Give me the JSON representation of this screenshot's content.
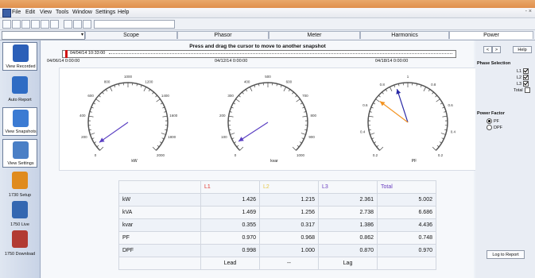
{
  "menu": {
    "items": [
      "File",
      "Edit",
      "View",
      "Tools",
      "Window",
      "Settings",
      "Help"
    ],
    "window_controls": "- ×"
  },
  "tabs": {
    "combo_arrow": "▾",
    "items": [
      "Scope",
      "Phasor",
      "Meter",
      "Harmonics",
      "Power"
    ],
    "active": "Power"
  },
  "sidebar": {
    "items": [
      {
        "label": "View Recorded",
        "color": "#2b5fb8"
      },
      {
        "label": "Auto Report",
        "color": "#2f6cc4"
      },
      {
        "label": "View Snapshots",
        "color": "#3b7bd3"
      },
      {
        "label": "View Settings",
        "color": "#4a7fc6"
      },
      {
        "label": "1730 Setup",
        "color": "#e08b1e"
      },
      {
        "label": "1750 Live",
        "color": "#3467b1"
      },
      {
        "label": "1750 Download",
        "color": "#b23a32"
      }
    ]
  },
  "main": {
    "instruction": "Press and drag the cursor to move to another snapshot",
    "marker_time": "04/04/14 10:33:00",
    "timeline_dates": [
      "04/06/14 0:00:00",
      "04/12/14 0:00:00",
      "04/18/14 0:00:00"
    ],
    "gauges": [
      {
        "unit": "kW",
        "ticks": [
          "0",
          "200",
          "400",
          "600",
          "800",
          "1000",
          "1200",
          "1400",
          "1600",
          "1800",
          "2000"
        ],
        "needles": [
          {
            "angle": 215,
            "color": "#5a3fc2"
          }
        ]
      },
      {
        "unit": "kvar",
        "ticks": [
          "0",
          "100",
          "200",
          "300",
          "400",
          "500",
          "600",
          "700",
          "800",
          "900",
          "1000"
        ],
        "needles": [
          {
            "angle": 213,
            "color": "#5a3fc2"
          }
        ]
      },
      {
        "unit": "PF",
        "ticks": [
          "0.2",
          "0.4",
          "0.6",
          "0.8",
          "1",
          "0.8",
          "0.6",
          "0.4",
          "0.2"
        ],
        "needles": [
          {
            "angle": 108,
            "color": "#2a2aa6"
          },
          {
            "angle": 143,
            "color": "#f39320"
          }
        ]
      }
    ]
  },
  "table": {
    "headers": [
      "",
      "L1",
      "L2",
      "L3",
      "Total"
    ],
    "header_colors": [
      "#111111",
      "#e0322a",
      "#e4c84a",
      "#6a3fc0",
      "#6a3fc0"
    ],
    "rows": [
      {
        "label": "kW",
        "values": [
          "1.426",
          "1.215",
          "2.361",
          "5.002"
        ]
      },
      {
        "label": "kVA",
        "values": [
          "1.469",
          "1.256",
          "2.738",
          "6.686"
        ]
      },
      {
        "label": "kvar",
        "values": [
          "0.355",
          "0.317",
          "1.386",
          "4.436"
        ]
      },
      {
        "label": "PF",
        "values": [
          "0.970",
          "0.968",
          "0.862",
          "0.748"
        ]
      },
      {
        "label": "DPF",
        "values": [
          "0.998",
          "1.000",
          "0.870",
          "0.970"
        ]
      },
      {
        "label": "",
        "values": [
          "Lead",
          "--",
          "Lag",
          ""
        ]
      }
    ]
  },
  "right": {
    "prev_label": "<",
    "next_label": ">",
    "help_label": "Help",
    "phase_title": "Phase Selection",
    "phases": [
      {
        "label": "L1",
        "checked": true
      },
      {
        "label": "L2",
        "checked": true
      },
      {
        "label": "L3",
        "checked": true
      },
      {
        "label": "Total",
        "checked": false
      }
    ],
    "pf_title": "Power Factor",
    "pf_options": [
      {
        "label": "PF",
        "checked": true
      },
      {
        "label": "DPF",
        "checked": false
      }
    ],
    "log_button": "Log to Report"
  }
}
